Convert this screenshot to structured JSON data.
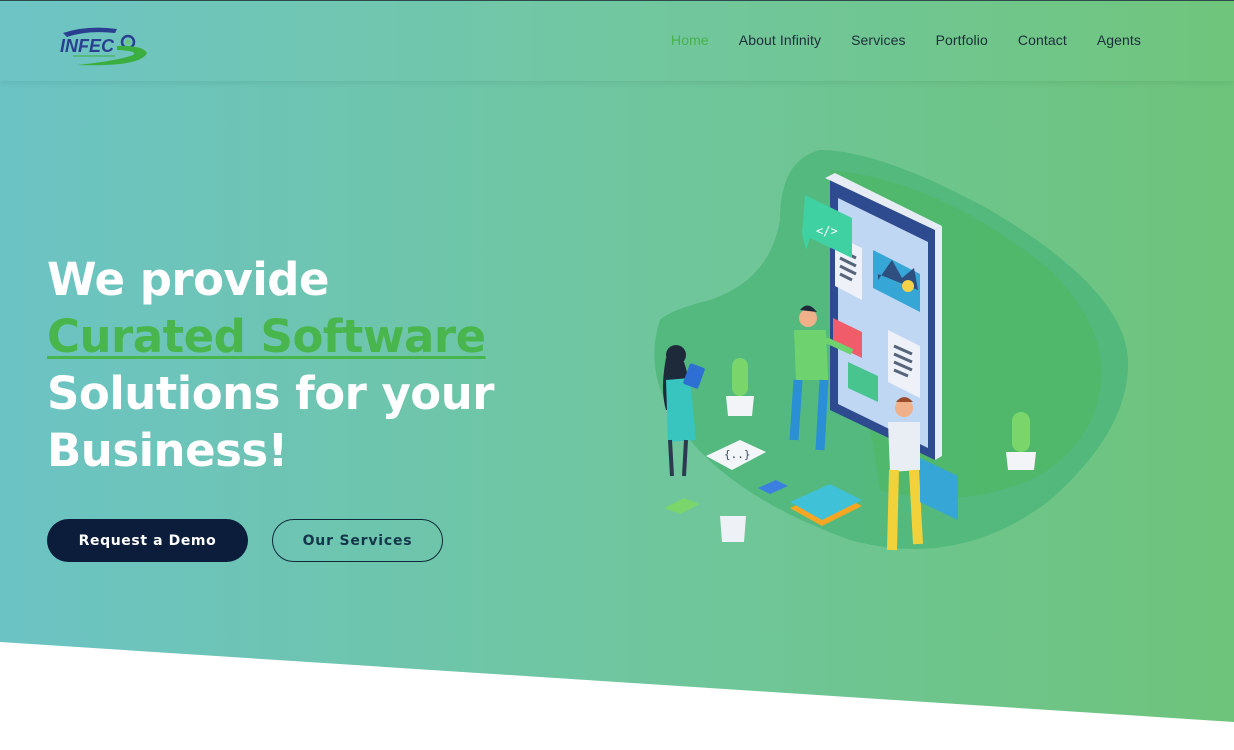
{
  "nav": {
    "items": [
      {
        "label": "Home",
        "active": true
      },
      {
        "label": "About Infinity",
        "active": false
      },
      {
        "label": "Services",
        "active": false
      },
      {
        "label": "Portfolio",
        "active": false
      },
      {
        "label": "Contact",
        "active": false
      },
      {
        "label": "Agents",
        "active": false
      }
    ]
  },
  "logo": {
    "text": "INFEC",
    "icon": "infec-logo"
  },
  "hero": {
    "line1": "We provide",
    "highlight": "Curated Software",
    "line3": "Solutions for your",
    "line4": "Business!",
    "primary_button": "Request a Demo",
    "secondary_button": "Our Services",
    "illustration_icon": "app-development-illustration"
  },
  "colors": {
    "accent": "#48b64c",
    "nav_active": "#47b24a",
    "dark_button": "#0b1d3b",
    "gradient_start": "#6cc3c4",
    "gradient_end": "#6ec47a"
  }
}
